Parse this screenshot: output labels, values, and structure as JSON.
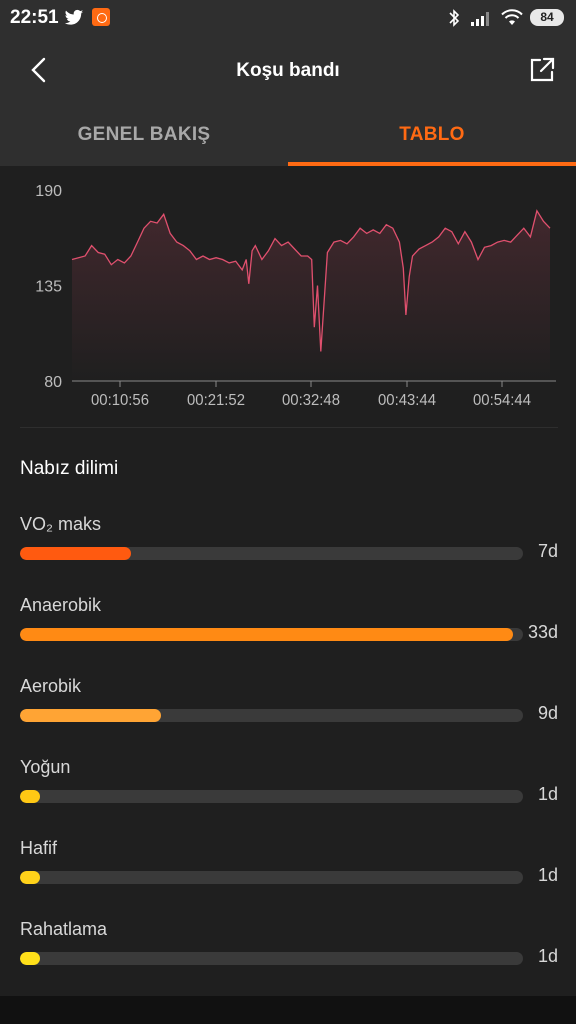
{
  "status_bar": {
    "time": "22:51",
    "battery": "84",
    "icons": [
      "twitter-icon",
      "app-badge-icon",
      "bluetooth-icon",
      "signal-icon",
      "wifi-icon",
      "battery-icon"
    ]
  },
  "header": {
    "title": "Koşu bandı",
    "back_icon": "chevron-left-icon",
    "share_icon": "share-icon"
  },
  "tabs": [
    {
      "label": "GENEL BAKIŞ",
      "active": false
    },
    {
      "label": "TABLO",
      "active": true
    }
  ],
  "colors": {
    "accent": "#ff6a13",
    "chart_line": "#e0506e",
    "vo2": "#ff5a10",
    "anaerobic": "#ff8a14",
    "aerobic": "#ffa434",
    "intense": "#ffc814",
    "light": "#ffd21a",
    "relax": "#ffe01a"
  },
  "chart_data": {
    "type": "line",
    "title": "",
    "xlabel": "",
    "ylabel": "",
    "ylim": [
      80,
      190
    ],
    "y_ticks": [
      "190",
      "135",
      "80"
    ],
    "x_ticks": [
      "00:10:56",
      "00:21:52",
      "00:32:48",
      "00:43:44",
      "00:54:44"
    ],
    "grid": false,
    "series": [
      {
        "points": [
          [
            0,
            150
          ],
          [
            2,
            152
          ],
          [
            3,
            158
          ],
          [
            4,
            154
          ],
          [
            5,
            153
          ],
          [
            6,
            147
          ],
          [
            7,
            150
          ],
          [
            8,
            148
          ],
          [
            9,
            152
          ],
          [
            10,
            160
          ],
          [
            11,
            168
          ],
          [
            12,
            172
          ],
          [
            13,
            171
          ],
          [
            14,
            176
          ],
          [
            15,
            165
          ],
          [
            16,
            160
          ],
          [
            17,
            158
          ],
          [
            18,
            155
          ],
          [
            19,
            150
          ],
          [
            20,
            152
          ],
          [
            21,
            150
          ],
          [
            22,
            151
          ],
          [
            23,
            150
          ],
          [
            24,
            148
          ],
          [
            25,
            149
          ],
          [
            26,
            144
          ],
          [
            26.6,
            150
          ],
          [
            27,
            136
          ],
          [
            27.5,
            155
          ],
          [
            28,
            158
          ],
          [
            29,
            150
          ],
          [
            30,
            155
          ],
          [
            31,
            162
          ],
          [
            32,
            158
          ],
          [
            33,
            160
          ],
          [
            34,
            156
          ],
          [
            35,
            152
          ],
          [
            36,
            152
          ],
          [
            36.6,
            150
          ],
          [
            37,
            111
          ],
          [
            37.5,
            135
          ],
          [
            38,
            97
          ],
          [
            39,
            154
          ],
          [
            40,
            160
          ],
          [
            41,
            161
          ],
          [
            42,
            159
          ],
          [
            43,
            163
          ],
          [
            44,
            168
          ],
          [
            45,
            165
          ],
          [
            46,
            167
          ],
          [
            47,
            165
          ],
          [
            48,
            170
          ],
          [
            49,
            168
          ],
          [
            50,
            160
          ],
          [
            50.6,
            145
          ],
          [
            51,
            118
          ],
          [
            51.5,
            140
          ],
          [
            52,
            152
          ],
          [
            53,
            156
          ],
          [
            54,
            158
          ],
          [
            55,
            160
          ],
          [
            56,
            163
          ],
          [
            57,
            168
          ],
          [
            58,
            166
          ],
          [
            59,
            159
          ],
          [
            60,
            166
          ],
          [
            61,
            160
          ],
          [
            62,
            150
          ],
          [
            63,
            157
          ],
          [
            64,
            158
          ],
          [
            65,
            160
          ],
          [
            66,
            161
          ],
          [
            67,
            160
          ],
          [
            68,
            164
          ],
          [
            69,
            168
          ],
          [
            70,
            163
          ],
          [
            71,
            178
          ],
          [
            72,
            172
          ],
          [
            73,
            168
          ]
        ]
      }
    ]
  },
  "heart_zones": {
    "title": "Nabız dilimi",
    "items": [
      {
        "label": "VO₂ maks",
        "value": "7d",
        "fraction": 0.22,
        "color": "#ff5a10"
      },
      {
        "label": "Anaerobik",
        "value": "33d",
        "fraction": 0.98,
        "color": "#ff8a14"
      },
      {
        "label": "Aerobik",
        "value": "9d",
        "fraction": 0.28,
        "color": "#ffa434"
      },
      {
        "label": "Yoğun",
        "value": "1d",
        "fraction": 0.04,
        "color": "#ffc814"
      },
      {
        "label": "Hafif",
        "value": "1d",
        "fraction": 0.04,
        "color": "#ffd21a"
      },
      {
        "label": "Rahatlama",
        "value": "1d",
        "fraction": 0.04,
        "color": "#ffe01a"
      }
    ]
  }
}
